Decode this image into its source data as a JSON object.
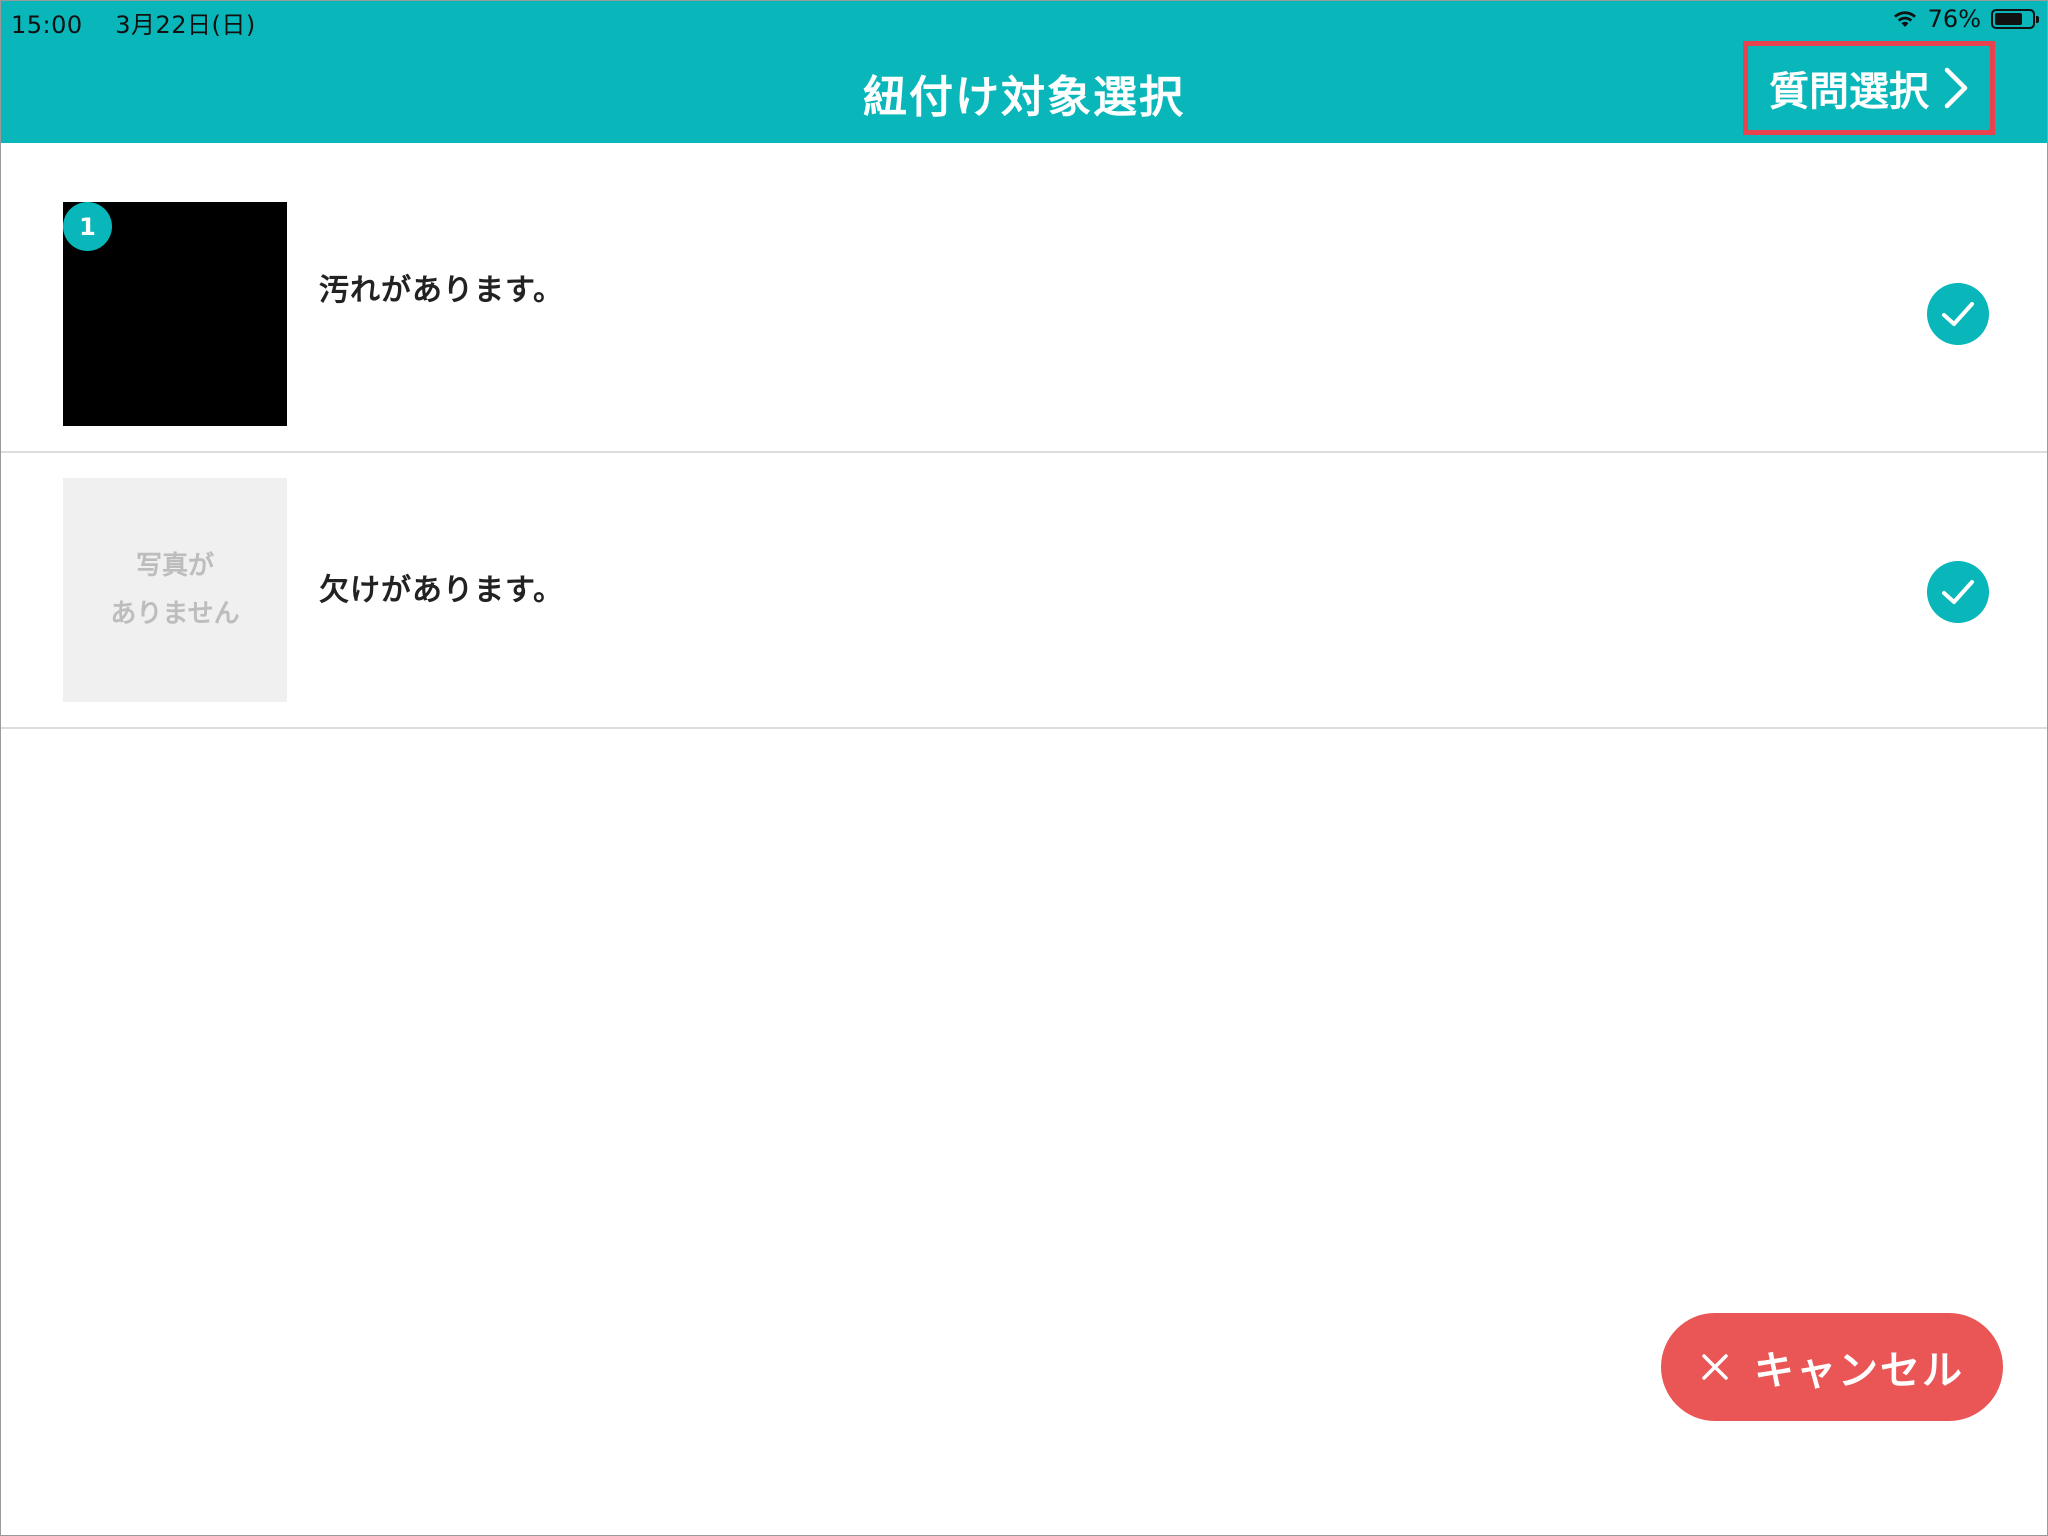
{
  "status_bar": {
    "time": "15:00",
    "date": "3月22日(日)",
    "battery_text": "76%",
    "battery_level": 0.76
  },
  "header": {
    "title": "紐付け対象選択",
    "next_label": "質問選択",
    "background_color": "#09b6b9",
    "highlight_color": "#e8424e"
  },
  "items": [
    {
      "badge": "1",
      "label": "汚れがあります。",
      "has_photo": true,
      "checked": true
    },
    {
      "placeholder_line1": "写真が",
      "placeholder_line2": "ありません",
      "label": "欠けがあります。",
      "has_photo": false,
      "checked": true
    }
  ],
  "cancel_button": {
    "label": "キャンセル",
    "icon": "close-icon",
    "color": "#ea5555"
  }
}
